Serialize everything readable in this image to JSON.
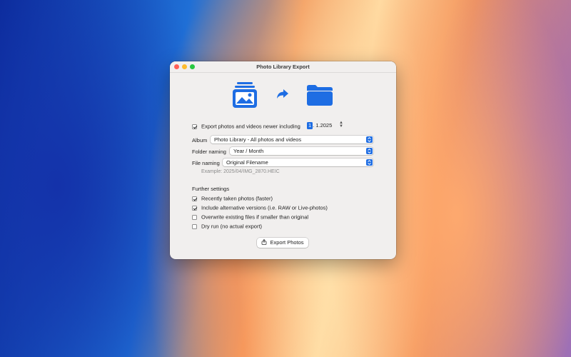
{
  "window": {
    "title": "Photo Library Export"
  },
  "icons": {
    "photos": "photo-stack-icon",
    "arrow": "share-arrow-icon",
    "folder": "folder-icon",
    "export": "export-icon"
  },
  "export_newer": {
    "checked": true,
    "label": "Export photos and videos newer including",
    "date_selected": "1",
    "date_rest": ". 1.2025"
  },
  "album": {
    "label": "Album",
    "value": "Photo Library - All photos and videos"
  },
  "folder_naming": {
    "label": "Folder naming",
    "value": "Year / Month"
  },
  "file_naming": {
    "label": "File naming",
    "value": "Original Filename"
  },
  "example": "Example: 2025/04/IMG_2870.HEIC",
  "further": {
    "title": "Further settings",
    "options": [
      {
        "label": "Recently taken photos (faster)",
        "checked": true
      },
      {
        "label": "Include alternative versions (i.e. RAW or Live-photos)",
        "checked": true
      },
      {
        "label": "Overwrite existing files if smaller than original",
        "checked": false
      },
      {
        "label": "Dry run (no actual export)",
        "checked": false
      }
    ]
  },
  "export_button": "Export Photos",
  "colors": {
    "accent": "#1e6de3",
    "close": "#ff5f57",
    "minimize": "#febc2e",
    "maximize": "#28c840"
  }
}
